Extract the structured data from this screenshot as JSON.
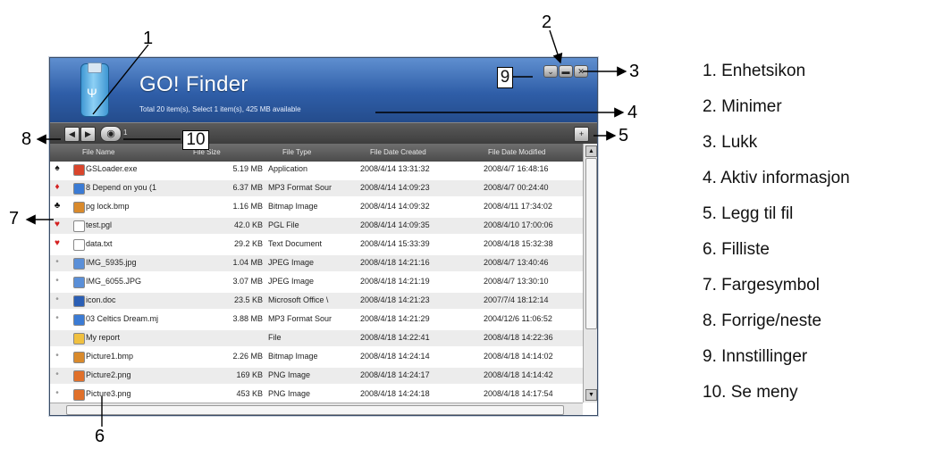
{
  "app": {
    "title": "GO! Finder",
    "status": "Total 20 item(s), Select 1 item(s), 425 MB available",
    "view_count": "1",
    "window_buttons": {
      "settings": "⌄",
      "minimize": "▬",
      "close": "✕"
    },
    "toolbar": {
      "prev": "◀",
      "next": "▶",
      "view": "◉",
      "add": "+"
    },
    "device_icon_glyph": "Ψ"
  },
  "table": {
    "columns": [
      "File Name",
      "File Size",
      "File Type",
      "File Date Created",
      "File Date Modified"
    ],
    "rows": [
      {
        "sym": "♠",
        "sym_color": "#111111",
        "icon_color": "#d9452c",
        "name": "GSLoader.exe",
        "size": "5.19 MB",
        "type": "Application",
        "created": "2008/4/14 13:31:32",
        "modified": "2008/4/7 16:48:16"
      },
      {
        "sym": "♦",
        "sym_color": "#d42020",
        "icon_color": "#3b7bd4",
        "name": "8 Depend on you (1",
        "size": "6.37 MB",
        "type": "MP3 Format Sour",
        "created": "2008/4/14 14:09:23",
        "modified": "2008/4/7 00:24:40"
      },
      {
        "sym": "♣",
        "sym_color": "#111111",
        "icon_color": "#d98a2c",
        "name": "pg lock.bmp",
        "size": "1.16 MB",
        "type": "Bitmap Image",
        "created": "2008/4/14 14:09:32",
        "modified": "2008/4/11 17:34:02"
      },
      {
        "sym": "♥",
        "sym_color": "#d42020",
        "icon_color": "#ffffff",
        "name": "test.pgl",
        "size": "42.0 KB",
        "type": "PGL File",
        "created": "2008/4/14 14:09:35",
        "modified": "2008/4/10 17:00:06"
      },
      {
        "sym": "♥",
        "sym_color": "#d42020",
        "icon_color": "#ffffff",
        "name": "data.txt",
        "size": "29.2 KB",
        "type": "Text Document",
        "created": "2008/4/14 15:33:39",
        "modified": "2008/4/18 15:32:38"
      },
      {
        "sym": "•",
        "sym_color": "#999999",
        "icon_color": "#5a8fd8",
        "name": "IMG_5935.jpg",
        "size": "1.04 MB",
        "type": "JPEG Image",
        "created": "2008/4/18 14:21:16",
        "modified": "2008/4/7 13:40:46"
      },
      {
        "sym": "•",
        "sym_color": "#999999",
        "icon_color": "#5a8fd8",
        "name": "IMG_6055.JPG",
        "size": "3.07 MB",
        "type": "JPEG Image",
        "created": "2008/4/18 14:21:19",
        "modified": "2008/4/7 13:30:10"
      },
      {
        "sym": "•",
        "sym_color": "#999999",
        "icon_color": "#2b5fb5",
        "name": "icon.doc",
        "size": "23.5 KB",
        "type": "Microsoft Office \\",
        "created": "2008/4/18 14:21:23",
        "modified": "2007/7/4 18:12:14"
      },
      {
        "sym": "•",
        "sym_color": "#999999",
        "icon_color": "#3b7bd4",
        "name": "03 Celtics Dream.mj",
        "size": "3.88 MB",
        "type": "MP3 Format Sour",
        "created": "2008/4/18 14:21:29",
        "modified": "2004/12/6 11:06:52"
      },
      {
        "sym": "",
        "sym_color": "#999999",
        "icon_color": "#f0c040",
        "name": "My report",
        "size": "",
        "type": "File",
        "created": "2008/4/18 14:22:41",
        "modified": "2008/4/18 14:22:36"
      },
      {
        "sym": "•",
        "sym_color": "#999999",
        "icon_color": "#d98a2c",
        "name": "Picture1.bmp",
        "size": "2.26 MB",
        "type": "Bitmap Image",
        "created": "2008/4/18 14:24:14",
        "modified": "2008/4/18 14:14:02"
      },
      {
        "sym": "•",
        "sym_color": "#999999",
        "icon_color": "#e0702a",
        "name": "Picture2.png",
        "size": "169 KB",
        "type": "PNG Image",
        "created": "2008/4/18 14:24:17",
        "modified": "2008/4/18 14:14:42"
      },
      {
        "sym": "•",
        "sym_color": "#999999",
        "icon_color": "#e0702a",
        "name": "Picture3.png",
        "size": "453 KB",
        "type": "PNG Image",
        "created": "2008/4/18 14:24:18",
        "modified": "2008/4/18 14:17:54"
      }
    ]
  },
  "callouts": {
    "n1": "1",
    "n2": "2",
    "n3": "3",
    "n4": "4",
    "n5": "5",
    "n6": "6",
    "n7": "7",
    "n8": "8",
    "n9": "9",
    "n10": "10"
  },
  "legend": [
    "1. Enhetsikon",
    "2. Minimer",
    "3. Lukk",
    "4. Aktiv informasjon",
    "5. Legg til fil",
    "6. Filliste",
    "7. Fargesymbol",
    "8. Forrige/neste",
    "9. Innstillinger",
    "10. Se meny"
  ]
}
